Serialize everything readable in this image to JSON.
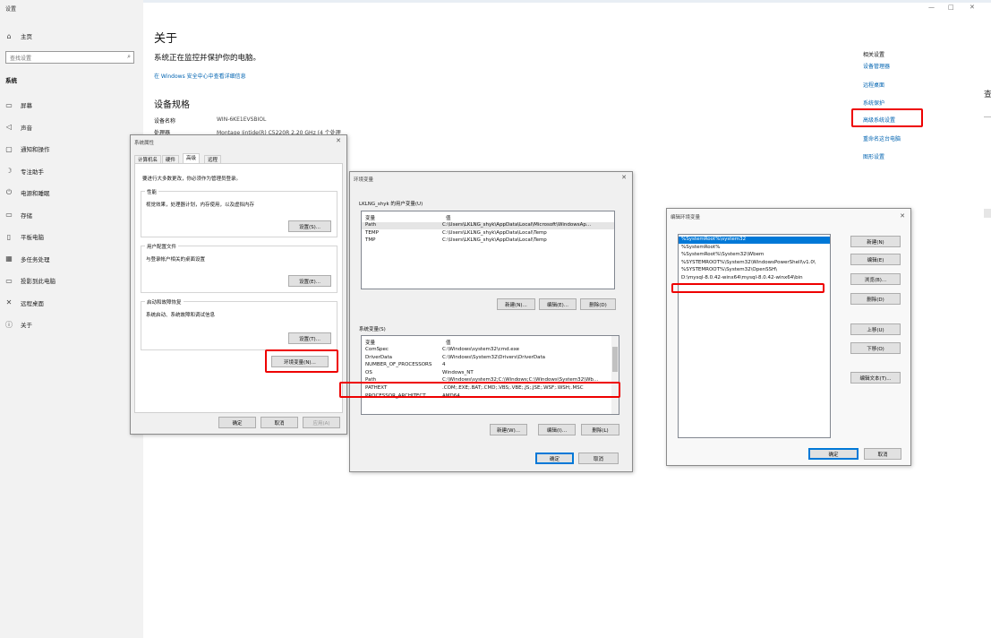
{
  "settings": {
    "app_title": "设置",
    "home": "主页",
    "search_placeholder": "查找设置",
    "section": "系统",
    "nav": [
      {
        "icon": "monitor-icon",
        "glyph": "▭",
        "label": "屏幕"
      },
      {
        "icon": "speaker-icon",
        "glyph": "◁",
        "label": "声音"
      },
      {
        "icon": "notification-icon",
        "glyph": "▢",
        "label": "通知和操作"
      },
      {
        "icon": "moon-icon",
        "glyph": "☽",
        "label": "专注助手"
      },
      {
        "icon": "power-icon",
        "glyph": "⏻",
        "label": "电源和睡眠"
      },
      {
        "icon": "storage-icon",
        "glyph": "▭",
        "label": "存储"
      },
      {
        "icon": "tablet-icon",
        "glyph": "▯",
        "label": "平板电脑"
      },
      {
        "icon": "multitask-icon",
        "glyph": "▦",
        "label": "多任务处理"
      },
      {
        "icon": "project-icon",
        "glyph": "▭",
        "label": "投影到此电脑"
      },
      {
        "icon": "remote-icon",
        "glyph": "✕",
        "label": "远程桌面"
      },
      {
        "icon": "info-icon",
        "glyph": "ⓘ",
        "label": "关于"
      }
    ],
    "window_controls": [
      "—",
      "□",
      "✕"
    ]
  },
  "about": {
    "title": "关于",
    "protect_text": "系统正在监控并保护你的电脑。",
    "security_link": "在 Windows 安全中心中查看详细信息",
    "specs_title": "设备规格",
    "device_name_label": "设备名称",
    "device_name_value": "WIN-6KE1EVSBIOL",
    "processor_label": "处理器",
    "processor_value": "Montage Jintide(R) C5220R   2.20 GHz  (4 个处理",
    "related_title": "相关设置",
    "related_links": [
      "设备管理器",
      "远程桌面",
      "系统保护",
      "高级系统设置",
      "重命名这台电脑",
      "图形设置"
    ],
    "edge_glyph": "查"
  },
  "sysprops": {
    "title": "系统属性",
    "tabs": [
      "计算机名",
      "硬件",
      "高级",
      "远程"
    ],
    "admin_note": "要进行大多数更改，你必须作为管理员登录。",
    "perf_title": "性能",
    "perf_desc": "视觉效果，处理器计划，内存使用，以及虚拟内存",
    "perf_btn": "设置(S)...",
    "profile_title": "用户配置文件",
    "profile_desc": "与登录帐户相关的桌面设置",
    "profile_btn": "设置(E)...",
    "startup_title": "启动和故障恢复",
    "startup_desc": "系统启动、系统故障和调试信息",
    "startup_btn": "设置(T)...",
    "env_btn": "环境变量(N)...",
    "ok": "确定",
    "cancel": "取消",
    "apply": "应用(A)"
  },
  "envvars": {
    "title": "环境变量",
    "user_group": "LKLNG_shyk 的用户变量(U)",
    "col_var": "变量",
    "col_val": "值",
    "user_rows": [
      {
        "name": "Path",
        "value": "C:\\Users\\LKLNG_shyk\\AppData\\Local\\Microsoft\\WindowsAp..."
      },
      {
        "name": "TEMP",
        "value": "C:\\Users\\LKLNG_shyk\\AppData\\Local\\Temp"
      },
      {
        "name": "TMP",
        "value": "C:\\Users\\LKLNG_shyk\\AppData\\Local\\Temp"
      }
    ],
    "user_new": "新建(N)...",
    "user_edit": "编辑(E)...",
    "user_delete": "删除(D)",
    "sys_group": "系统变量(S)",
    "sys_rows": [
      {
        "name": "ComSpec",
        "value": "C:\\Windows\\system32\\cmd.exe"
      },
      {
        "name": "DriverData",
        "value": "C:\\Windows\\System32\\Drivers\\DriverData"
      },
      {
        "name": "NUMBER_OF_PROCESSORS",
        "value": "4"
      },
      {
        "name": "OS",
        "value": "Windows_NT"
      },
      {
        "name": "Path",
        "value": "C:\\Windows\\system32;C:\\Windows;C:\\Windows\\System32\\Wb..."
      },
      {
        "name": "PATHEXT",
        "value": ".COM;.EXE;.BAT;.CMD;.VBS;.VBE;.JS;.JSE;.WSF;.WSH;.MSC"
      },
      {
        "name": "PROCESSOR_ARCHITECT...",
        "value": "AMD64"
      }
    ],
    "sys_new": "新建(W)...",
    "sys_edit": "编辑(I)...",
    "sys_delete": "删除(L)",
    "ok": "确定",
    "cancel": "取消"
  },
  "editenv": {
    "title": "编辑环境变量",
    "items": [
      "%SystemRoot%\\system32",
      "%SystemRoot%",
      "%SystemRoot%\\System32\\Wbem",
      "%SYSTEMROOT%\\System32\\WindowsPowerShell\\v1.0\\",
      "%SYSTEMROOT%\\System32\\OpenSSH\\",
      "D:\\mysql-8.0.42-winx64\\mysql-8.0.42-winx64\\bin"
    ],
    "new": "新建(N)",
    "edit": "编辑(E)",
    "browse": "浏览(B)...",
    "delete": "删除(D)",
    "up": "上移(U)",
    "down": "下移(O)",
    "edit_text": "编辑文本(T)...",
    "ok": "确定",
    "cancel": "取消"
  }
}
